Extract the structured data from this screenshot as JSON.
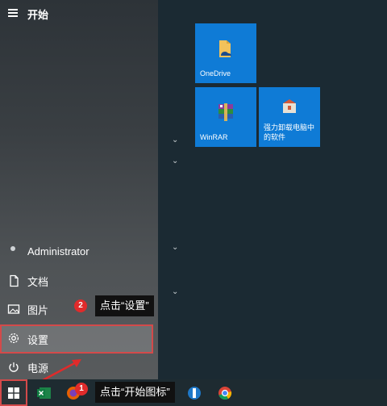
{
  "start_menu": {
    "title": "开始",
    "user": "Administrator",
    "items": [
      {
        "label": "文档",
        "icon": "document-icon"
      },
      {
        "label": "图片",
        "icon": "picture-icon"
      },
      {
        "label": "设置",
        "icon": "gear-icon"
      },
      {
        "label": "电源",
        "icon": "power-icon"
      }
    ]
  },
  "tiles": [
    {
      "label": "OneDrive",
      "icon": "onedrive-folder-icon"
    },
    {
      "label": "WinRAR",
      "icon": "winrar-icon"
    },
    {
      "label": "强力卸载电脑中的软件",
      "icon": "uninstall-box-icon"
    }
  ],
  "annotations": {
    "step1": {
      "number": "1",
      "text": "点击“开始图标”"
    },
    "step2": {
      "number": "2",
      "text": "点击“设置”"
    }
  },
  "colors": {
    "tile": "#0f7bd6",
    "highlight": "#d34a4a",
    "badge": "#e02b2b"
  }
}
